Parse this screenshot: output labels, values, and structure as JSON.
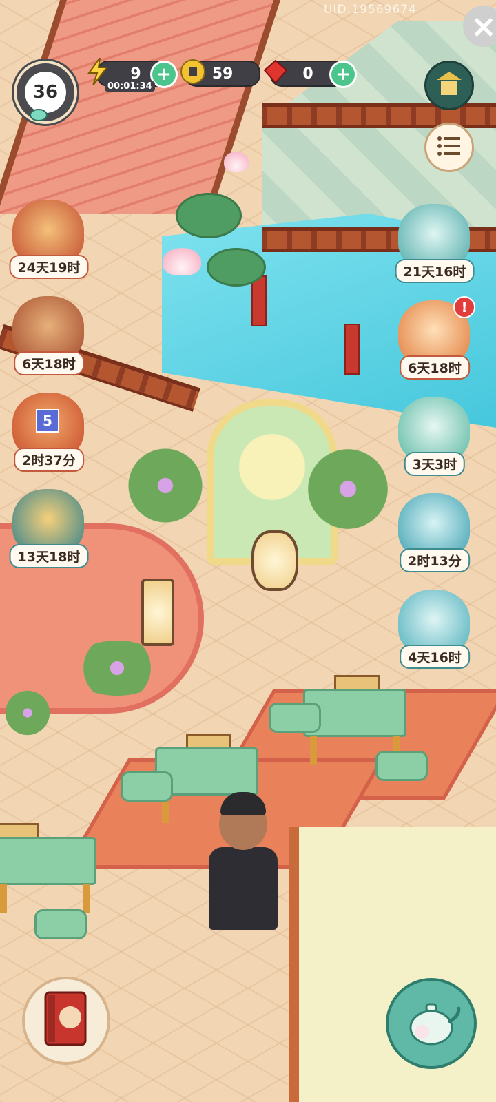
{
  "hud": {
    "level": "36",
    "energy": "9",
    "energy_timer": "00:01:34",
    "coins": "59",
    "gems": "0",
    "uid": "UID:19569674"
  },
  "events_left": [
    {
      "label": "24天19时"
    },
    {
      "label": "6天18时"
    },
    {
      "label": "2时37分",
      "badge": "5"
    },
    {
      "label": "13天18时"
    }
  ],
  "events_right": [
    {
      "label": "21天16时"
    },
    {
      "label": "6天18时",
      "alert": "!"
    },
    {
      "label": "3天3时"
    },
    {
      "label": "2时13分"
    },
    {
      "label": "4天16时"
    }
  ],
  "icons": {
    "energy": "lightning-icon",
    "coin": "coin-icon",
    "gem": "gem-icon",
    "plus": "+",
    "close": "×",
    "menu": "menu-icon",
    "shop": "shop-icon",
    "book": "book-icon",
    "teapot": "teapot-icon"
  },
  "colors": {
    "plus_green": "#4cc58d",
    "pill_dark": "#3f3f45",
    "alert_red": "#e23c3c"
  }
}
